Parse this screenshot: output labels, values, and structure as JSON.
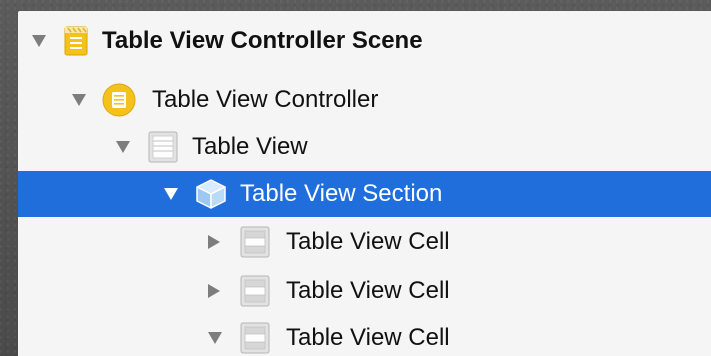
{
  "outline": {
    "items": [
      {
        "label": "Table View Controller Scene",
        "expanded": true,
        "icon": "scene-icon",
        "selected": false
      },
      {
        "label": "Table View Controller",
        "expanded": true,
        "icon": "table-view-controller-icon",
        "selected": false
      },
      {
        "label": "Table View",
        "expanded": true,
        "icon": "table-view-icon",
        "selected": false
      },
      {
        "label": "Table View Section",
        "expanded": true,
        "icon": "section-cube-icon",
        "selected": true
      },
      {
        "label": "Table View Cell",
        "expanded": false,
        "icon": "table-view-cell-icon",
        "selected": false
      },
      {
        "label": "Table View Cell",
        "expanded": false,
        "icon": "table-view-cell-icon",
        "selected": false
      },
      {
        "label": "Table View Cell",
        "expanded": true,
        "icon": "table-view-cell-icon",
        "selected": false
      }
    ]
  },
  "colors": {
    "selection": "#1f6edc",
    "panel_background": "#f5f5f5",
    "scene_icon": "#f5c21b",
    "disclosure": "#7d7d7d"
  }
}
